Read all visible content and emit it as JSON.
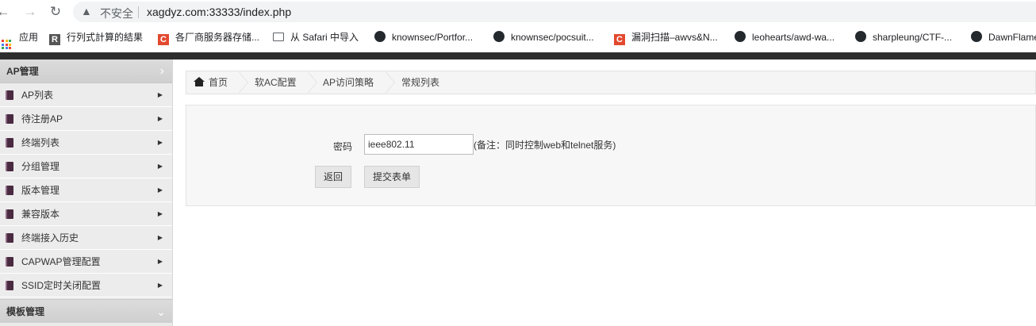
{
  "browser": {
    "insecure_label": "不安全",
    "url": "xagdyz.com:33333/index.php",
    "bookmarks": [
      {
        "label": "应用",
        "icon": "apps-grid-icon"
      },
      {
        "label": "行列式計算的結果",
        "icon": "r-favicon-icon"
      },
      {
        "label": "各厂商服务器存储...",
        "icon": "c-favicon-icon"
      },
      {
        "label": "从 Safari 中导入",
        "icon": "folder-icon"
      },
      {
        "label": "knownsec/Portfor...",
        "icon": "github-icon"
      },
      {
        "label": "knownsec/pocsuit...",
        "icon": "github-icon"
      },
      {
        "label": "漏洞扫描–awvs&N...",
        "icon": "c-favicon-icon"
      },
      {
        "label": "leohearts/awd-wa...",
        "icon": "github-icon"
      },
      {
        "label": "sharpleung/CTF-...",
        "icon": "github-icon"
      },
      {
        "label": "DawnFlame",
        "icon": "github-icon"
      }
    ]
  },
  "sidebar": {
    "section_title": "AP管理",
    "items": [
      {
        "label": "AP列表"
      },
      {
        "label": "待注册AP"
      },
      {
        "label": "终端列表"
      },
      {
        "label": "分组管理"
      },
      {
        "label": "版本管理"
      },
      {
        "label": "兼容版本"
      },
      {
        "label": "终端接入历史"
      },
      {
        "label": "CAPWAP管理配置"
      },
      {
        "label": "SSID定时关闭配置"
      }
    ],
    "section2_title": "模板管理"
  },
  "breadcrumb": [
    "首页",
    "软AC配置",
    "AP访问策略",
    "常规列表"
  ],
  "form": {
    "password_label": "密码",
    "password_value": "ieee802.11",
    "note": "(备注：同时控制web和telnet服务)",
    "back_label": "返回",
    "submit_label": "提交表单"
  }
}
